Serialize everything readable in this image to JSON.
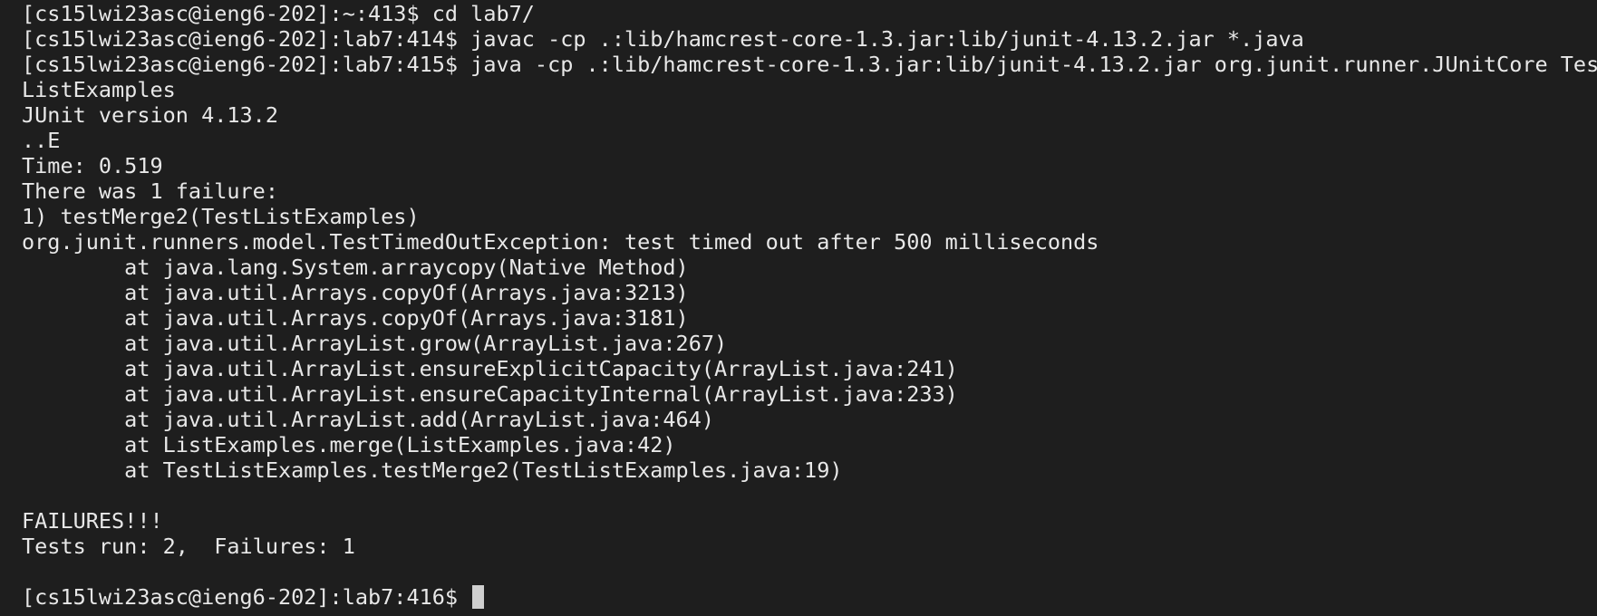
{
  "terminal": {
    "background_color": "#1e1e1e",
    "text_color": "#e8e8e8",
    "cursor_color": "#cfcfcf",
    "lines": [
      "[cs15lwi23asc@ieng6-202]:~:413$ cd lab7/",
      "[cs15lwi23asc@ieng6-202]:lab7:414$ javac -cp .:lib/hamcrest-core-1.3.jar:lib/junit-4.13.2.jar *.java",
      "[cs15lwi23asc@ieng6-202]:lab7:415$ java -cp .:lib/hamcrest-core-1.3.jar:lib/junit-4.13.2.jar org.junit.runner.JUnitCore Test",
      "ListExamples",
      "JUnit version 4.13.2",
      "..E",
      "Time: 0.519",
      "There was 1 failure:",
      "1) testMerge2(TestListExamples)",
      "org.junit.runners.model.TestTimedOutException: test timed out after 500 milliseconds",
      "        at java.lang.System.arraycopy(Native Method)",
      "        at java.util.Arrays.copyOf(Arrays.java:3213)",
      "        at java.util.Arrays.copyOf(Arrays.java:3181)",
      "        at java.util.ArrayList.grow(ArrayList.java:267)",
      "        at java.util.ArrayList.ensureExplicitCapacity(ArrayList.java:241)",
      "        at java.util.ArrayList.ensureCapacityInternal(ArrayList.java:233)",
      "        at java.util.ArrayList.add(ArrayList.java:464)",
      "        at ListExamples.merge(ListExamples.java:42)",
      "        at TestListExamples.testMerge2(TestListExamples.java:19)",
      "",
      "FAILURES!!!",
      "Tests run: 2,  Failures: 1",
      ""
    ],
    "prompt": "[cs15lwi23asc@ieng6-202]:lab7:416$ "
  }
}
